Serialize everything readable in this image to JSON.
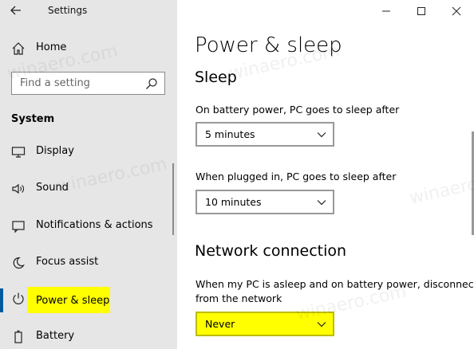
{
  "window": {
    "title": "Settings"
  },
  "sidebar": {
    "home_label": "Home",
    "search_placeholder": "Find a setting",
    "section": "System",
    "items": [
      {
        "label": "Display",
        "icon": "monitor-icon"
      },
      {
        "label": "Sound",
        "icon": "speaker-icon"
      },
      {
        "label": "Notifications & actions",
        "icon": "notification-icon"
      },
      {
        "label": "Focus assist",
        "icon": "moon-icon"
      },
      {
        "label": "Power & sleep",
        "icon": "power-icon",
        "active": true
      },
      {
        "label": "Battery",
        "icon": "battery-icon"
      }
    ]
  },
  "main": {
    "title": "Power & sleep",
    "sleep": {
      "heading": "Sleep",
      "battery_label": "On battery power, PC goes to sleep after",
      "battery_value": "5 minutes",
      "plugged_label": "When plugged in, PC goes to sleep after",
      "plugged_value": "10 minutes"
    },
    "network": {
      "heading": "Network connection",
      "label": "When my PC is asleep and on battery power, disconnect from the network",
      "value": "Never"
    }
  },
  "watermark": "winaero.com",
  "colors": {
    "sidebar_bg": "#e6e6e6",
    "accent": "#005a9e",
    "highlight": "#ffff00"
  }
}
